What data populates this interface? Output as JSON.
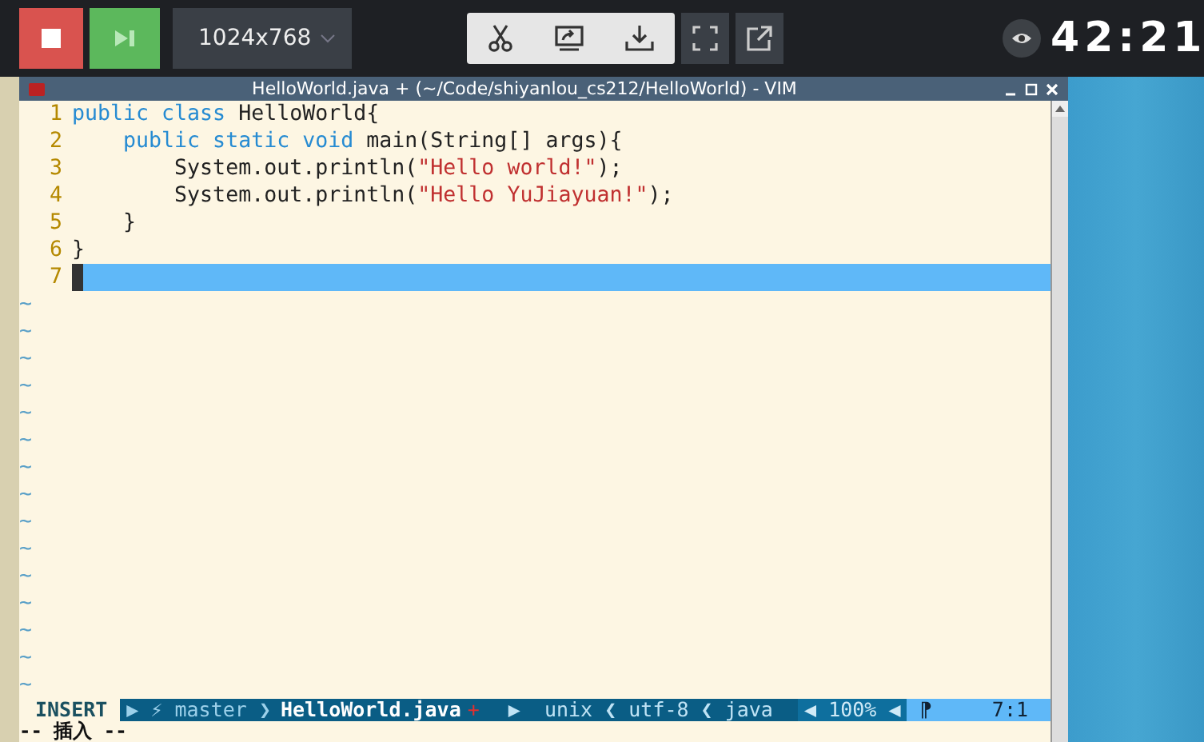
{
  "toolbar": {
    "resolution": "1024x768",
    "timer": "42:21"
  },
  "window": {
    "title": "HelloWorld.java + (~/Code/shiyanlou_cs212/HelloWorld) - VIM"
  },
  "editor": {
    "lines": [
      {
        "number": "1",
        "current": false,
        "segments": [
          {
            "kind": "keyword",
            "text": "public class"
          },
          {
            "kind": "plain",
            "text": " HelloWorld{"
          }
        ]
      },
      {
        "number": "2",
        "current": false,
        "segments": [
          {
            "kind": "keyword",
            "text": "    public static void"
          },
          {
            "kind": "plain",
            "text": " main(String[] args){"
          }
        ]
      },
      {
        "number": "3",
        "current": false,
        "segments": [
          {
            "kind": "plain",
            "text": "        System.out.println("
          },
          {
            "kind": "string",
            "text": "\"Hello world!\""
          },
          {
            "kind": "plain",
            "text": ");"
          }
        ]
      },
      {
        "number": "4",
        "current": false,
        "segments": [
          {
            "kind": "plain",
            "text": "        System.out.println("
          },
          {
            "kind": "string",
            "text": "\"Hello YuJiayuan!\""
          },
          {
            "kind": "plain",
            "text": ");"
          }
        ]
      },
      {
        "number": "5",
        "current": false,
        "segments": [
          {
            "kind": "plain",
            "text": "    }"
          }
        ]
      },
      {
        "number": "6",
        "current": false,
        "segments": [
          {
            "kind": "plain",
            "text": "}"
          }
        ]
      },
      {
        "number": "7",
        "current": true
      }
    ],
    "filler_lines": [
      "~",
      "~",
      "~",
      "~",
      "~",
      "~",
      "~",
      "~",
      "~",
      "~",
      "~",
      "~",
      "~",
      "~",
      "~"
    ]
  },
  "status_line": {
    "segments": [
      {
        "kind": "mode",
        "text": "INSERT"
      },
      {
        "kind": "branch",
        "text": "▶ ⚡ master ❯"
      },
      {
        "kind": "file",
        "text": "HelloWorld.java"
      },
      {
        "kind": "modified",
        "text": "+"
      },
      {
        "kind": "info",
        "text": "▶  unix ❮ utf-8 ❮ java"
      },
      {
        "kind": "percent",
        "text": "◀ 100% ◀"
      },
      {
        "kind": "position",
        "text": "⁋     7:1"
      }
    ]
  },
  "command_line": "-- 插入 --"
}
